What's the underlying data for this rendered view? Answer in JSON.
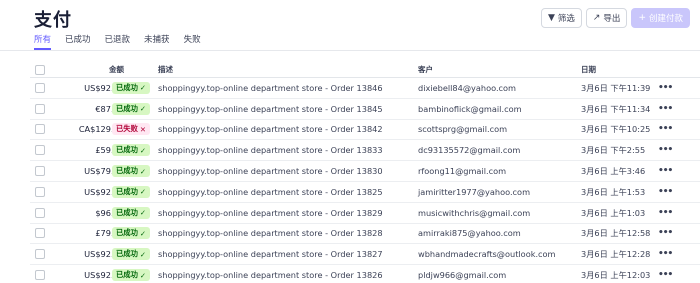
{
  "header": {
    "title": "支付"
  },
  "actions": {
    "filter_label": "筛选",
    "export_label": "导出",
    "create_label": "创建付款"
  },
  "tabs": [
    "所有",
    "已成功",
    "已退款",
    "未捕获",
    "失败"
  ],
  "columns": {
    "amount": "金额",
    "description": "描述",
    "customer": "客户",
    "date": "日期"
  },
  "colors": {
    "accent": "#635bff",
    "success_bg": "#d7f7c2",
    "success_fg": "#05690d",
    "failed_bg": "#ffe7f2",
    "failed_fg": "#b3093c"
  },
  "rows": [
    {
      "amount": "US$92.99",
      "status": "已成功",
      "status_type": "ok",
      "description": "shoppingyy.top-online department store - Order 13846",
      "customer": "dixiebell84@yahoo.com",
      "date": "3月6日 下午11:39"
    },
    {
      "amount": "€87.59",
      "status": "已成功",
      "status_type": "ok",
      "description": "shoppingyy.top-online department store - Order 13845",
      "customer": "bambinoflick@gmail.com",
      "date": "3月6日 下午11:34"
    },
    {
      "amount": "CA$129.79",
      "status": "已失败",
      "status_type": "fail",
      "description": "shoppingyy.top-online department store - Order 13842",
      "customer": "scottsprg@gmail.com",
      "date": "3月6日 下午10:25"
    },
    {
      "amount": "£59.95",
      "status": "已成功",
      "status_type": "ok",
      "description": "shoppingyy.top-online department store - Order 13833",
      "customer": "dc93135572@gmail.com",
      "date": "3月6日 下午2:55"
    },
    {
      "amount": "US$79.99",
      "status": "已成功",
      "status_type": "ok",
      "description": "shoppingyy.top-online department store - Order 13830",
      "customer": "rfoong11@gmail.com",
      "date": "3月6日 上午3:46"
    },
    {
      "amount": "US$92.99",
      "status": "已成功",
      "status_type": "ok",
      "description": "shoppingyy.top-online department store - Order 13825",
      "customer": "jamiritter1977@yahoo.com",
      "date": "3月6日 上午1:53"
    },
    {
      "amount": "$96.00",
      "status": "已成功",
      "status_type": "ok",
      "description": "shoppingyy.top-online department store - Order 13829",
      "customer": "musicwithchris@gmail.com",
      "date": "3月6日 上午1:03"
    },
    {
      "amount": "£79.99",
      "status": "已成功",
      "status_type": "ok",
      "description": "shoppingyy.top-online department store - Order 13828",
      "customer": "amirraki875@yahoo.com",
      "date": "3月6日 上午12:58"
    },
    {
      "amount": "US$92.99",
      "status": "已成功",
      "status_type": "ok",
      "description": "shoppingyy.top-online department store - Order 13827",
      "customer": "wbhandmadecrafts@outlook.com",
      "date": "3月6日 上午12:28"
    },
    {
      "amount": "US$92.99",
      "status": "已成功",
      "status_type": "ok",
      "description": "shoppingyy.top-online department store - Order 13826",
      "customer": "pldjw966@gmail.com",
      "date": "3月6日 上午12:03"
    }
  ]
}
